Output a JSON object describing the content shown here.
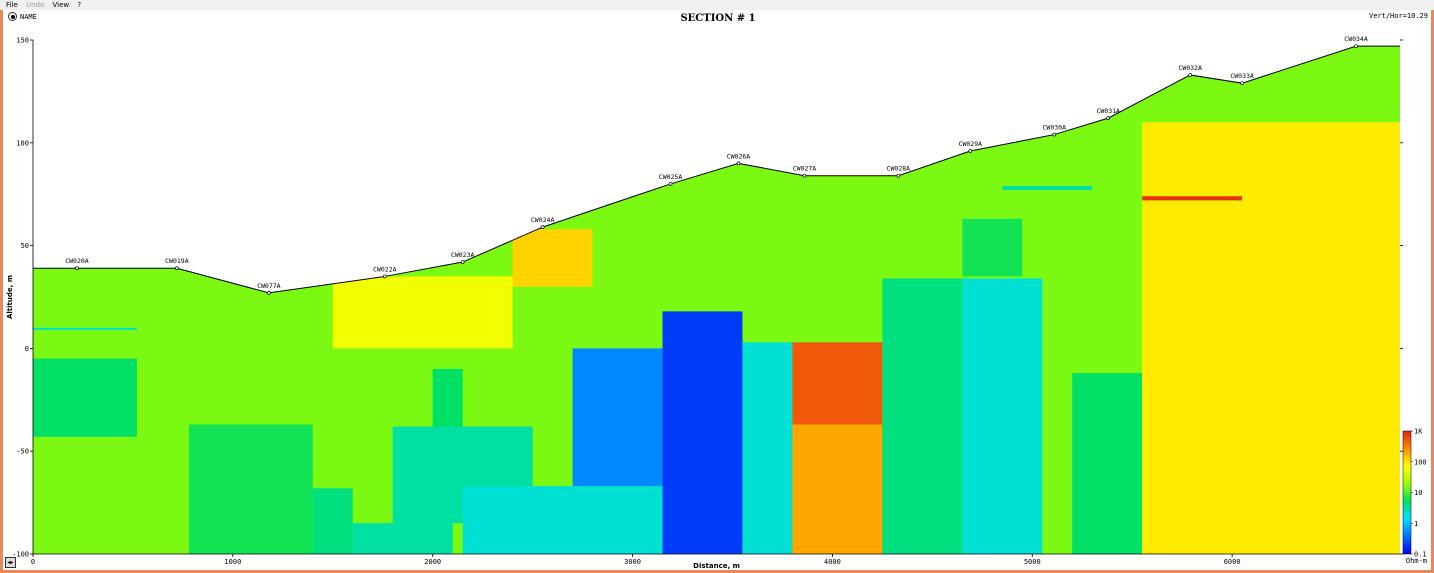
{
  "menu": {
    "file": "File",
    "undo": "Undo",
    "view": "View",
    "help": "?"
  },
  "toolbar": {
    "name_toggle": "NAME",
    "ratio": "Vert/Hor=10.29"
  },
  "chart_data": {
    "type": "heatmap",
    "title": "SECTION # 1",
    "xlabel": "Distance, m",
    "ylabel": "Altitude, m",
    "xlim": [
      0,
      6840
    ],
    "ylim": [
      -100,
      150
    ],
    "x_ticks": [
      0,
      1000,
      2000,
      3000,
      4000,
      5000,
      6000
    ],
    "y_ticks": [
      150,
      100,
      50,
      0,
      -50,
      -100
    ],
    "colorbar": {
      "unit": "Ohm-m",
      "ticks": [
        "1K",
        "100",
        "10",
        "1",
        "0.1"
      ],
      "colors": [
        "#e02010",
        "#ff8c00",
        "#ffff00",
        "#9aff00",
        "#00e060",
        "#00e0ff",
        "#0070ff",
        "#0000ee"
      ]
    },
    "stations": [
      {
        "name": "CW020A",
        "x": 220,
        "z": 39
      },
      {
        "name": "CW019A",
        "x": 720,
        "z": 39
      },
      {
        "name": "CW077A",
        "x": 1180,
        "z": 27
      },
      {
        "name": "CW022A",
        "x": 1760,
        "z": 35
      },
      {
        "name": "CW023A",
        "x": 2150,
        "z": 42
      },
      {
        "name": "CW024A",
        "x": 2550,
        "z": 59
      },
      {
        "name": "CW025A",
        "x": 3190,
        "z": 80
      },
      {
        "name": "CW026A",
        "x": 3530,
        "z": 90
      },
      {
        "name": "CW027A",
        "x": 3860,
        "z": 84
      },
      {
        "name": "CW028A",
        "x": 4330,
        "z": 84
      },
      {
        "name": "CW029A",
        "x": 4690,
        "z": 96
      },
      {
        "name": "CW030A",
        "x": 5110,
        "z": 104
      },
      {
        "name": "CW031A",
        "x": 5380,
        "z": 112
      },
      {
        "name": "CW032A",
        "x": 5790,
        "z": 133
      },
      {
        "name": "CW033A",
        "x": 6050,
        "z": 129
      },
      {
        "name": "CW034A",
        "x": 6620,
        "z": 147
      }
    ],
    "topography": [
      [
        0,
        39
      ],
      [
        720,
        39
      ],
      [
        1180,
        27
      ],
      [
        1760,
        35
      ],
      [
        2150,
        42
      ],
      [
        2550,
        59
      ],
      [
        3190,
        80
      ],
      [
        3530,
        90
      ],
      [
        3860,
        84
      ],
      [
        4330,
        84
      ],
      [
        4690,
        96
      ],
      [
        5110,
        104
      ],
      [
        5380,
        112
      ],
      [
        5790,
        133
      ],
      [
        6050,
        129
      ],
      [
        6620,
        147
      ],
      [
        6840,
        147
      ]
    ],
    "resistivity_blocks": [
      {
        "x": [
          0,
          6840
        ],
        "z": [
          -100,
          150
        ],
        "rho": 15
      },
      {
        "x": [
          0,
          520
        ],
        "z": [
          -43,
          -5
        ],
        "rho": 5
      },
      {
        "x": [
          0,
          520
        ],
        "z": [
          9,
          10
        ],
        "rho": 2
      },
      {
        "x": [
          780,
          1400
        ],
        "z": [
          -100,
          -37
        ],
        "rho": 6
      },
      {
        "x": [
          1400,
          1600
        ],
        "z": [
          -100,
          -68
        ],
        "rho": 4
      },
      {
        "x": [
          1600,
          2100
        ],
        "z": [
          -100,
          -85
        ],
        "rho": 3
      },
      {
        "x": [
          1800,
          2500
        ],
        "z": [
          -85,
          -38
        ],
        "rho": 3
      },
      {
        "x": [
          2000,
          2150
        ],
        "z": [
          -38,
          -10
        ],
        "rho": 5
      },
      {
        "x": [
          1500,
          2400
        ],
        "z": [
          0,
          35
        ],
        "rho": 60
      },
      {
        "x": [
          2150,
          3300
        ],
        "z": [
          -100,
          -67
        ],
        "rho": 2
      },
      {
        "x": [
          2400,
          2800
        ],
        "z": [
          30,
          58
        ],
        "rho": 120
      },
      {
        "x": [
          2700,
          3500
        ],
        "z": [
          -67,
          0
        ],
        "rho": 0.5
      },
      {
        "x": [
          3150,
          3550
        ],
        "z": [
          -100,
          18
        ],
        "rho": 0.2
      },
      {
        "x": [
          3550,
          3800
        ],
        "z": [
          -100,
          3
        ],
        "rho": 2
      },
      {
        "x": [
          3800,
          4250
        ],
        "z": [
          -100,
          3
        ],
        "rho": 500
      },
      {
        "x": [
          3800,
          4250
        ],
        "z": [
          -37,
          -100
        ],
        "rho": 200
      },
      {
        "x": [
          4250,
          4650
        ],
        "z": [
          -100,
          34
        ],
        "rho": 4
      },
      {
        "x": [
          4650,
          5050
        ],
        "z": [
          -100,
          34
        ],
        "rho": 2
      },
      {
        "x": [
          4650,
          4950
        ],
        "z": [
          35,
          63
        ],
        "rho": 6
      },
      {
        "x": [
          5200,
          5550
        ],
        "z": [
          -100,
          -12
        ],
        "rho": 5
      },
      {
        "x": [
          5550,
          6840
        ],
        "z": [
          -100,
          110
        ],
        "rho": 90
      },
      {
        "x": [
          5550,
          6050
        ],
        "z": [
          72,
          74
        ],
        "rho": 800
      },
      {
        "x": [
          4850,
          5300
        ],
        "z": [
          77,
          79
        ],
        "rho": 3
      }
    ]
  }
}
